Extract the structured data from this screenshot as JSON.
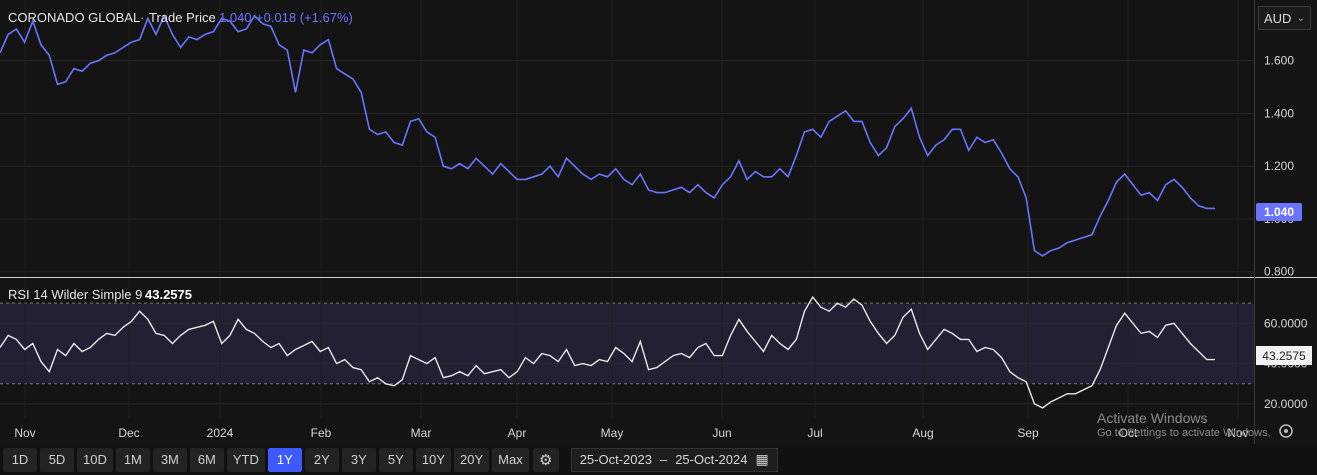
{
  "header": {
    "ticker": "CORONADO GLOBAL",
    "price_label": "Trade Price",
    "price": "1.040",
    "change": "+0.018 (+1.67%)"
  },
  "currency": {
    "selected": "AUD"
  },
  "rsi": {
    "label": "RSI 14 Wilder Simple 9",
    "value": "43.2575"
  },
  "last_price_badge": "1.040",
  "rsi_badge": "43.2575",
  "x_axis_labels": [
    "Nov",
    "Dec",
    "2024",
    "Feb",
    "Mar",
    "Apr",
    "May",
    "Jun",
    "Jul",
    "Aug",
    "Sep",
    "Oct",
    "Nov"
  ],
  "ranges": [
    "1D",
    "5D",
    "10D",
    "1M",
    "3M",
    "6M",
    "YTD",
    "1Y",
    "2Y",
    "3Y",
    "5Y",
    "10Y",
    "20Y",
    "Max"
  ],
  "active_range": "1Y",
  "date_from": "25-Oct-2023",
  "date_sep": "–",
  "date_to": "25-Oct-2024",
  "watermark": {
    "title": "Activate Windows",
    "sub": "Go to Settings to activate Windows."
  },
  "colors": {
    "price_line": "#6b74ff",
    "rsi_line": "#e8e8e8",
    "rsi_band": "#241f33",
    "active_btn": "#3d5afe"
  },
  "chart_data": [
    {
      "type": "line",
      "series": [
        {
          "name": "Trade Price",
          "values": [
            1.63,
            1.7,
            1.72,
            1.67,
            1.75,
            1.66,
            1.62,
            1.51,
            1.52,
            1.57,
            1.56,
            1.59,
            1.6,
            1.62,
            1.63,
            1.65,
            1.67,
            1.68,
            1.76,
            1.7,
            1.77,
            1.7,
            1.65,
            1.69,
            1.68,
            1.7,
            1.71,
            1.76,
            1.75,
            1.71,
            1.72,
            1.77,
            1.74,
            1.73,
            1.66,
            1.64,
            1.48,
            1.64,
            1.63,
            1.66,
            1.68,
            1.57,
            1.55,
            1.53,
            1.48,
            1.34,
            1.32,
            1.33,
            1.29,
            1.28,
            1.37,
            1.38,
            1.33,
            1.31,
            1.2,
            1.19,
            1.21,
            1.19,
            1.23,
            1.2,
            1.17,
            1.21,
            1.18,
            1.15,
            1.15,
            1.16,
            1.17,
            1.2,
            1.16,
            1.23,
            1.2,
            1.17,
            1.15,
            1.17,
            1.16,
            1.19,
            1.15,
            1.13,
            1.17,
            1.11,
            1.1,
            1.1,
            1.11,
            1.12,
            1.1,
            1.13,
            1.1,
            1.08,
            1.13,
            1.16,
            1.22,
            1.15,
            1.18,
            1.16,
            1.16,
            1.19,
            1.16,
            1.24,
            1.33,
            1.34,
            1.31,
            1.37,
            1.39,
            1.41,
            1.37,
            1.37,
            1.29,
            1.24,
            1.27,
            1.35,
            1.38,
            1.42,
            1.31,
            1.24,
            1.28,
            1.3,
            1.34,
            1.34,
            1.26,
            1.31,
            1.29,
            1.3,
            1.25,
            1.19,
            1.16,
            1.08,
            0.88,
            0.86,
            0.88,
            0.89,
            0.91,
            0.92,
            0.93,
            0.94,
            1.01,
            1.07,
            1.14,
            1.17,
            1.13,
            1.09,
            1.1,
            1.07,
            1.13,
            1.15,
            1.12,
            1.08,
            1.05,
            1.04,
            1.04
          ]
        }
      ],
      "yticks": [
        "0.800",
        "1.000",
        "1.200",
        "1.400",
        "1.600"
      ],
      "ylim": [
        0.78,
        1.83
      ]
    },
    {
      "type": "line",
      "series": [
        {
          "name": "RSI 14 Wilder Simple 9",
          "values": [
            48,
            54,
            52,
            47,
            50,
            41,
            36,
            47,
            44,
            50,
            46,
            48,
            52,
            55,
            54,
            58,
            61,
            66,
            62,
            55,
            54,
            50,
            54,
            57,
            58,
            59,
            61,
            50,
            54,
            62,
            57,
            55,
            51,
            48,
            50,
            44,
            47,
            49,
            51,
            46,
            48,
            40,
            42,
            38,
            37,
            31,
            33,
            30,
            29,
            32,
            44,
            42,
            40,
            43,
            33,
            34,
            36,
            34,
            39,
            35,
            36,
            37,
            33,
            36,
            43,
            40,
            45,
            44,
            41,
            47,
            39,
            40,
            39,
            42,
            41,
            48,
            45,
            41,
            51,
            37,
            38,
            41,
            44,
            45,
            43,
            48,
            50,
            44,
            44,
            54,
            62,
            56,
            51,
            46,
            54,
            50,
            47,
            52,
            66,
            73,
            68,
            66,
            70,
            68,
            72,
            69,
            61,
            55,
            50,
            54,
            63,
            67,
            55,
            47,
            52,
            57,
            55,
            52,
            52,
            46,
            48,
            47,
            43,
            36,
            33,
            31,
            20,
            18,
            21,
            23,
            25,
            25,
            27,
            29,
            37,
            48,
            59,
            65,
            60,
            55,
            56,
            53,
            59,
            60,
            55,
            50,
            46,
            42,
            42
          ]
        }
      ],
      "yticks": [
        "20.0000",
        "40.0000",
        "60.0000"
      ],
      "ylim": [
        13,
        82
      ],
      "band": [
        30,
        70
      ]
    }
  ]
}
